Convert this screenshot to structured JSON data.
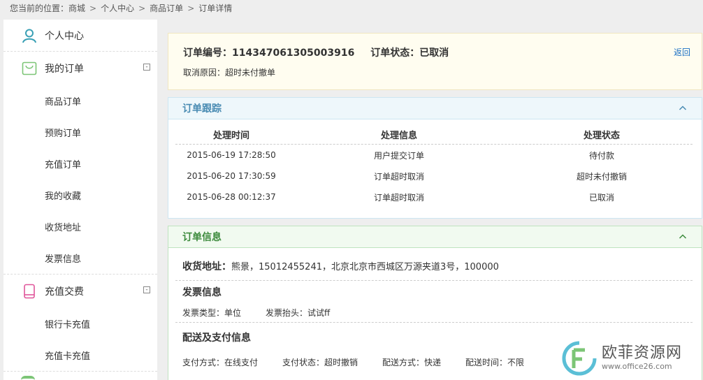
{
  "breadcrumb": {
    "prefix": "您当前的位置：",
    "items": [
      "商城",
      "个人中心",
      "商品订单",
      "订单详情"
    ],
    "separator": ">"
  },
  "sidebar": {
    "header": {
      "label": "个人中心",
      "icon": "user-icon"
    },
    "groups": [
      {
        "title": "我的订单",
        "icon": "bag-icon",
        "toggle": "-",
        "items": [
          "商品订单",
          "预购订单",
          "充值订单",
          "我的收藏",
          "收货地址",
          "发票信息"
        ]
      },
      {
        "title": "充值交费",
        "icon": "phone-icon",
        "toggle": "-",
        "items": [
          "银行卡充值",
          "充值卡充值"
        ]
      }
    ]
  },
  "order": {
    "number_label": "订单编号：",
    "number": "114347061305003916",
    "status_label": "订单状态：",
    "status": "已取消",
    "back_label": "返回",
    "cancel_reason_label": "取消原因：",
    "cancel_reason": "超时未付撤单"
  },
  "tracking": {
    "title": "订单跟踪",
    "headers": [
      "处理时间",
      "处理信息",
      "处理状态"
    ],
    "rows": [
      [
        "2015-06-19 17:28:50",
        "用户提交订单",
        "待付款"
      ],
      [
        "2015-06-20 17:30:59",
        "订单超时取消",
        "超时未付撤销"
      ],
      [
        "2015-06-28 00:12:37",
        "订单超时取消",
        "已取消"
      ]
    ]
  },
  "info": {
    "title": "订单信息",
    "address_label": "收货地址：",
    "address_value": "熊景，15012455241，北京北京市西城区万源夹道3号，100000",
    "invoice": {
      "title": "发票信息",
      "type_label": "发票类型：",
      "type_value": "单位",
      "header_label": "发票抬头：",
      "header_value": "试试ff"
    },
    "delivery": {
      "title": "配送及支付信息",
      "pay_method_label": "支付方式：",
      "pay_method_value": "在线支付",
      "pay_status_label": "支付状态：",
      "pay_status_value": "超时撤销",
      "ship_method_label": "配送方式：",
      "ship_method_value": "快递",
      "ship_time_label": "配送时间：",
      "ship_time_value": "不限"
    }
  },
  "watermark": {
    "title": "欧菲资源网",
    "url": "www.office26.com"
  },
  "colors": {
    "link": "#1a6fc4",
    "track_head": "#4a8cb3",
    "info_head": "#3c8a3c"
  }
}
